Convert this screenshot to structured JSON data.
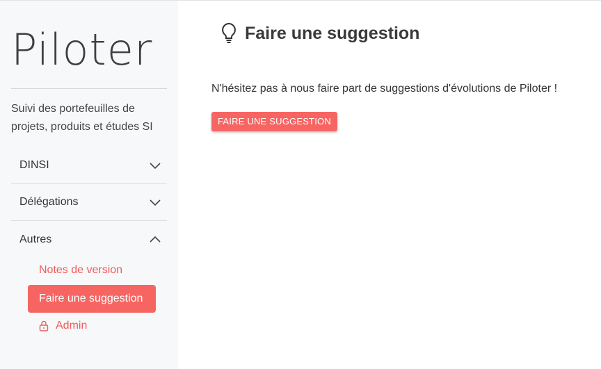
{
  "sidebar": {
    "logo": "Piloter",
    "tagline": "Suivi des portefeuilles de projets, produits et études SI",
    "nav": [
      {
        "label": "DINSI",
        "icon": "chevron-down-icon"
      },
      {
        "label": "Délégations",
        "icon": "chevron-down-icon"
      },
      {
        "label": "Autres",
        "icon": "chevron-up-icon"
      }
    ],
    "subnav": {
      "release_notes": "Notes de version",
      "suggestion": "Faire une suggestion",
      "admin": "Admin",
      "admin_icon": "lock-icon"
    }
  },
  "main": {
    "title": "Faire une suggestion",
    "title_icon": "lightbulb-icon",
    "intro": "N'hésitez pas à nous faire part de suggestions d'évolutions de Piloter !",
    "button_label": "FAIRE UNE SUGGESTION"
  },
  "colors": {
    "accent": "#f76562",
    "link": "#ef5b58",
    "sidebar_bg": "#f7f8fa"
  }
}
